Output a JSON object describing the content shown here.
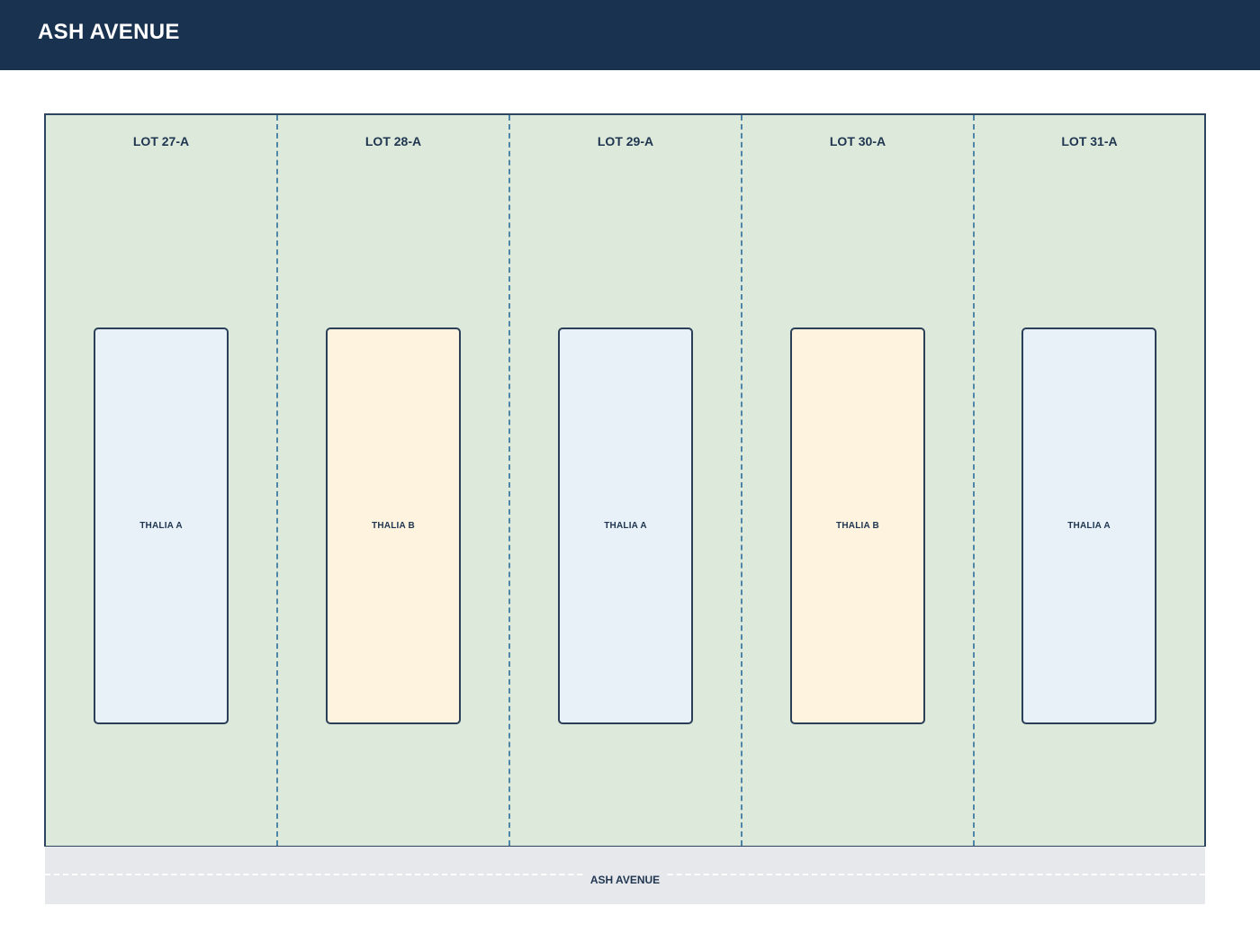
{
  "header": {
    "title": "ASH AVENUE"
  },
  "colors": {
    "header_bg": "#193250",
    "lot_fill": "#ddeadb",
    "lot_divider": "#4f86a8",
    "model_a_fill": "#e8f1f7",
    "model_b_fill": "#fdf3de",
    "road_fill": "#e6e8eb",
    "text_dark": "#1f3550"
  },
  "lots": [
    {
      "label": "LOT 27-A",
      "house": "THALIA A"
    },
    {
      "label": "LOT 28-A",
      "house": "THALIA B"
    },
    {
      "label": "LOT 29-A",
      "house": "THALIA A"
    },
    {
      "label": "LOT 30-A",
      "house": "THALIA B"
    },
    {
      "label": "LOT 31-A",
      "house": "THALIA A"
    }
  ],
  "road": {
    "label": "ASH AVENUE"
  }
}
